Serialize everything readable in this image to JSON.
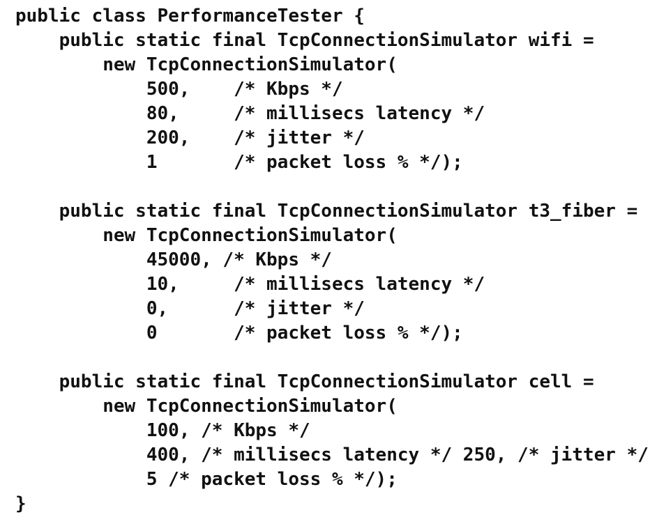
{
  "code": {
    "lines": [
      "public class PerformanceTester {",
      "    public static final TcpConnectionSimulator wifi =",
      "        new TcpConnectionSimulator(",
      "            500,    /* Kbps */",
      "            80,     /* millisecs latency */",
      "            200,    /* jitter */",
      "            1       /* packet loss % */);",
      "",
      "    public static final TcpConnectionSimulator t3_fiber =",
      "        new TcpConnectionSimulator(",
      "            45000, /* Kbps */",
      "            10,     /* millisecs latency */",
      "            0,      /* jitter */",
      "            0       /* packet loss % */);",
      "",
      "    public static final TcpConnectionSimulator cell =",
      "        new TcpConnectionSimulator(",
      "            100, /* Kbps */",
      "            400, /* millisecs latency */ 250, /* jitter */",
      "            5 /* packet loss % */);",
      "}"
    ]
  }
}
